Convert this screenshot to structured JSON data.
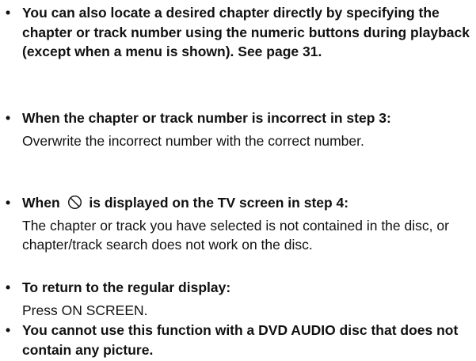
{
  "notes": [
    {
      "bullet": "•",
      "heading": "You can also locate a desired chapter directly by specifying the chapter or track number using the numeric buttons during playback (except when a menu is shown). See page 31."
    },
    {
      "bullet": "•",
      "heading": "When the chapter or track number is incorrect in step 3:",
      "body": "Overwrite the incorrect number with the correct number."
    },
    {
      "bullet": "•",
      "heading_before_icon": "When",
      "icon": "prohibited-icon",
      "heading_after_icon": "is displayed on the TV screen in step 4:",
      "body": "The chapter or track you have selected is not contained in the disc, or chapter/track search does not work on the disc."
    },
    {
      "bullet": "•",
      "heading": "To return to the regular display:",
      "body": "Press ON SCREEN."
    },
    {
      "bullet": "•",
      "heading": "You cannot use this function with a DVD AUDIO disc that does not contain any picture."
    }
  ]
}
